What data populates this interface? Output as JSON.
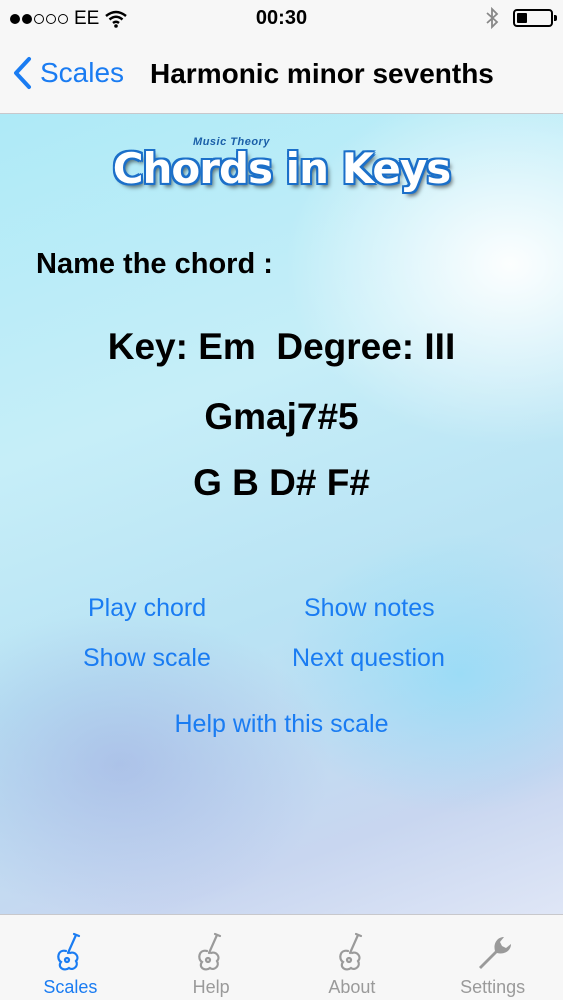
{
  "status_bar": {
    "carrier": "EE",
    "time": "00:30",
    "signal_bars_filled": 2,
    "signal_bars_total": 5,
    "battery_level": 0.3
  },
  "nav": {
    "back_label": "Scales",
    "title": "Harmonic minor sevenths"
  },
  "logo": {
    "small_text": "Music Theory",
    "main_text": "Chords in Keys"
  },
  "question": {
    "prompt": "Name the chord :",
    "key_line": "Key: Em  Degree: III",
    "chord_name": "Gmaj7#5",
    "chord_notes": "G B D# F#"
  },
  "actions": {
    "play_chord": "Play chord",
    "show_notes": "Show notes",
    "show_scale": "Show scale",
    "next_question": "Next question",
    "help_scale": "Help with this scale"
  },
  "tabs": [
    {
      "label": "Scales",
      "icon": "guitar-icon",
      "active": true
    },
    {
      "label": "Help",
      "icon": "guitar-icon",
      "active": false
    },
    {
      "label": "About",
      "icon": "guitar-icon",
      "active": false
    },
    {
      "label": "Settings",
      "icon": "wrench-icon",
      "active": false
    }
  ],
  "colors": {
    "accent": "#1a7cf2",
    "inactive_tab": "#9a9a9a"
  }
}
